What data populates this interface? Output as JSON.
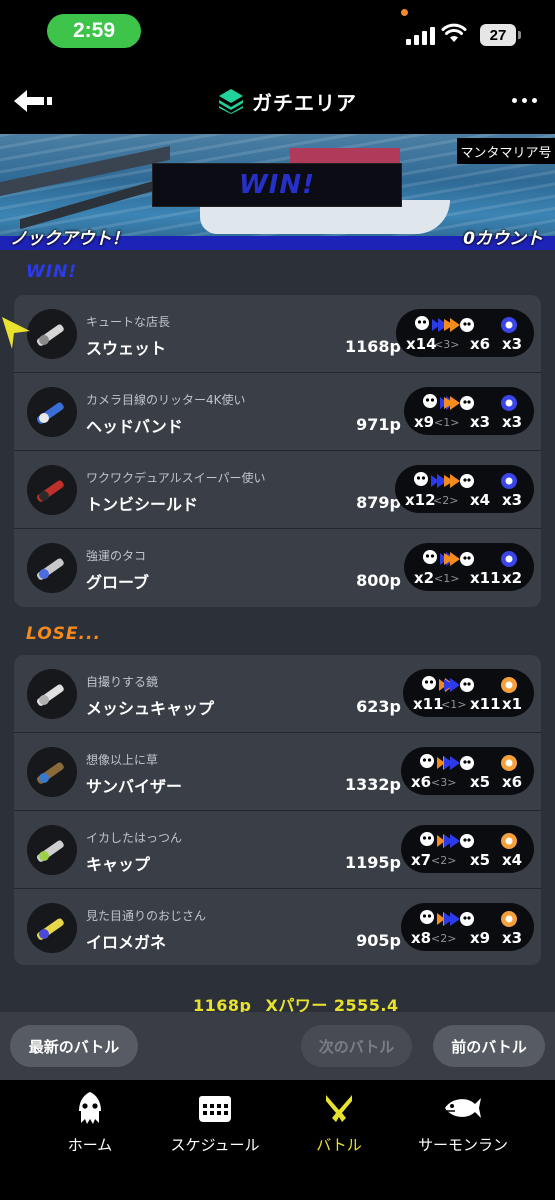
{
  "status_bar": {
    "time": "2:59",
    "battery": "27"
  },
  "header": {
    "title": "ガチエリア"
  },
  "banner": {
    "stage": "マンタマリア号",
    "result": "WIN!",
    "knockout": "ノックアウト！",
    "count": "0カウント"
  },
  "win_section": {
    "label": "WIN!",
    "players": [
      {
        "byname": "キュートな店長",
        "name": "スウェット",
        "points": "1168p",
        "kills": "x14",
        "assists": "<3>",
        "deaths": "x6",
        "specials": "x3"
      },
      {
        "byname": "カメラ目線のリッター4K使い",
        "name": "ヘッドバンド",
        "points": "971p",
        "kills": "x9",
        "assists": "<1>",
        "deaths": "x3",
        "specials": "x3"
      },
      {
        "byname": "ワクワクデュアルスイーパー使い",
        "name": "トンビシールド",
        "points": "879p",
        "kills": "x12",
        "assists": "<2>",
        "deaths": "x4",
        "specials": "x3"
      },
      {
        "byname": "強運のタコ",
        "name": "グローブ",
        "points": "800p",
        "kills": "x2",
        "assists": "<1>",
        "deaths": "x11",
        "specials": "x2"
      }
    ]
  },
  "lose_section": {
    "label": "LOSE...",
    "players": [
      {
        "byname": "自撮りする鏡",
        "name": "メッシュキャップ",
        "points": "623p",
        "kills": "x11",
        "assists": "<1>",
        "deaths": "x11",
        "specials": "x1"
      },
      {
        "byname": "想像以上に草",
        "name": "サンバイザー",
        "points": "1332p",
        "kills": "x6",
        "assists": "<3>",
        "deaths": "x5",
        "specials": "x6"
      },
      {
        "byname": "イカしたはっつん",
        "name": "キャップ",
        "points": "1195p",
        "kills": "x7",
        "assists": "<2>",
        "deaths": "x5",
        "specials": "x4"
      },
      {
        "byname": "見た目通りのおじさん",
        "name": "イロメガネ",
        "points": "905p",
        "kills": "x8",
        "assists": "<2>",
        "deaths": "x9",
        "specials": "x3"
      }
    ]
  },
  "summary": {
    "points": "1168p",
    "xpower": "Xパワー 2555.4"
  },
  "buttons": {
    "latest": "最新のバトル",
    "next": "次のバトル",
    "previous": "前のバトル"
  },
  "nav": [
    {
      "label": "ホーム",
      "icon": "squid-home-icon"
    },
    {
      "label": "スケジュール",
      "icon": "calendar-icon"
    },
    {
      "label": "バトル",
      "icon": "battle-icon",
      "active": true
    },
    {
      "label": "サーモンラン",
      "icon": "salmon-icon"
    }
  ],
  "colors": {
    "win": "#2b3aeb",
    "lose": "#f58a1f",
    "accent": "#e8e12e",
    "status_pill": "#3ec44b"
  }
}
